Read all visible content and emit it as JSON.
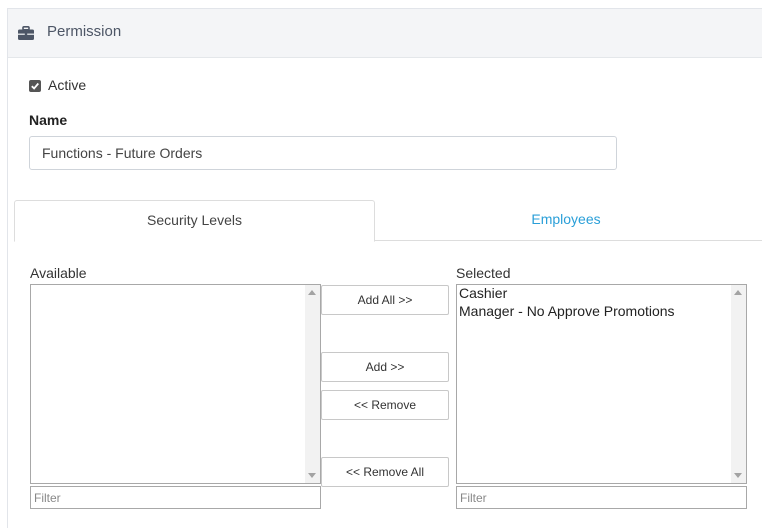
{
  "panel": {
    "title": "Permission",
    "title_icon": "briefcase-icon"
  },
  "form": {
    "active_label": "Active",
    "active_checked": true,
    "name_label": "Name",
    "name_value": "Functions - Future Orders"
  },
  "tabs": [
    {
      "label": "Security Levels",
      "active": true
    },
    {
      "label": "Employees",
      "active": false
    }
  ],
  "available": {
    "caption": "Available",
    "items": [],
    "filter_placeholder": "Filter"
  },
  "selected": {
    "caption": "Selected",
    "items": [
      "Cashier",
      "Manager - No Approve Promotions"
    ],
    "filter_placeholder": "Filter"
  },
  "buttons": {
    "add_all": "Add All >>",
    "add": "Add >>",
    "remove": "<< Remove",
    "remove_all": "<< Remove All"
  },
  "colors": {
    "link": "#2a9fd8",
    "header_bg": "#f4f5f7",
    "header_text": "#4d5666",
    "icon": "#4d5666"
  }
}
